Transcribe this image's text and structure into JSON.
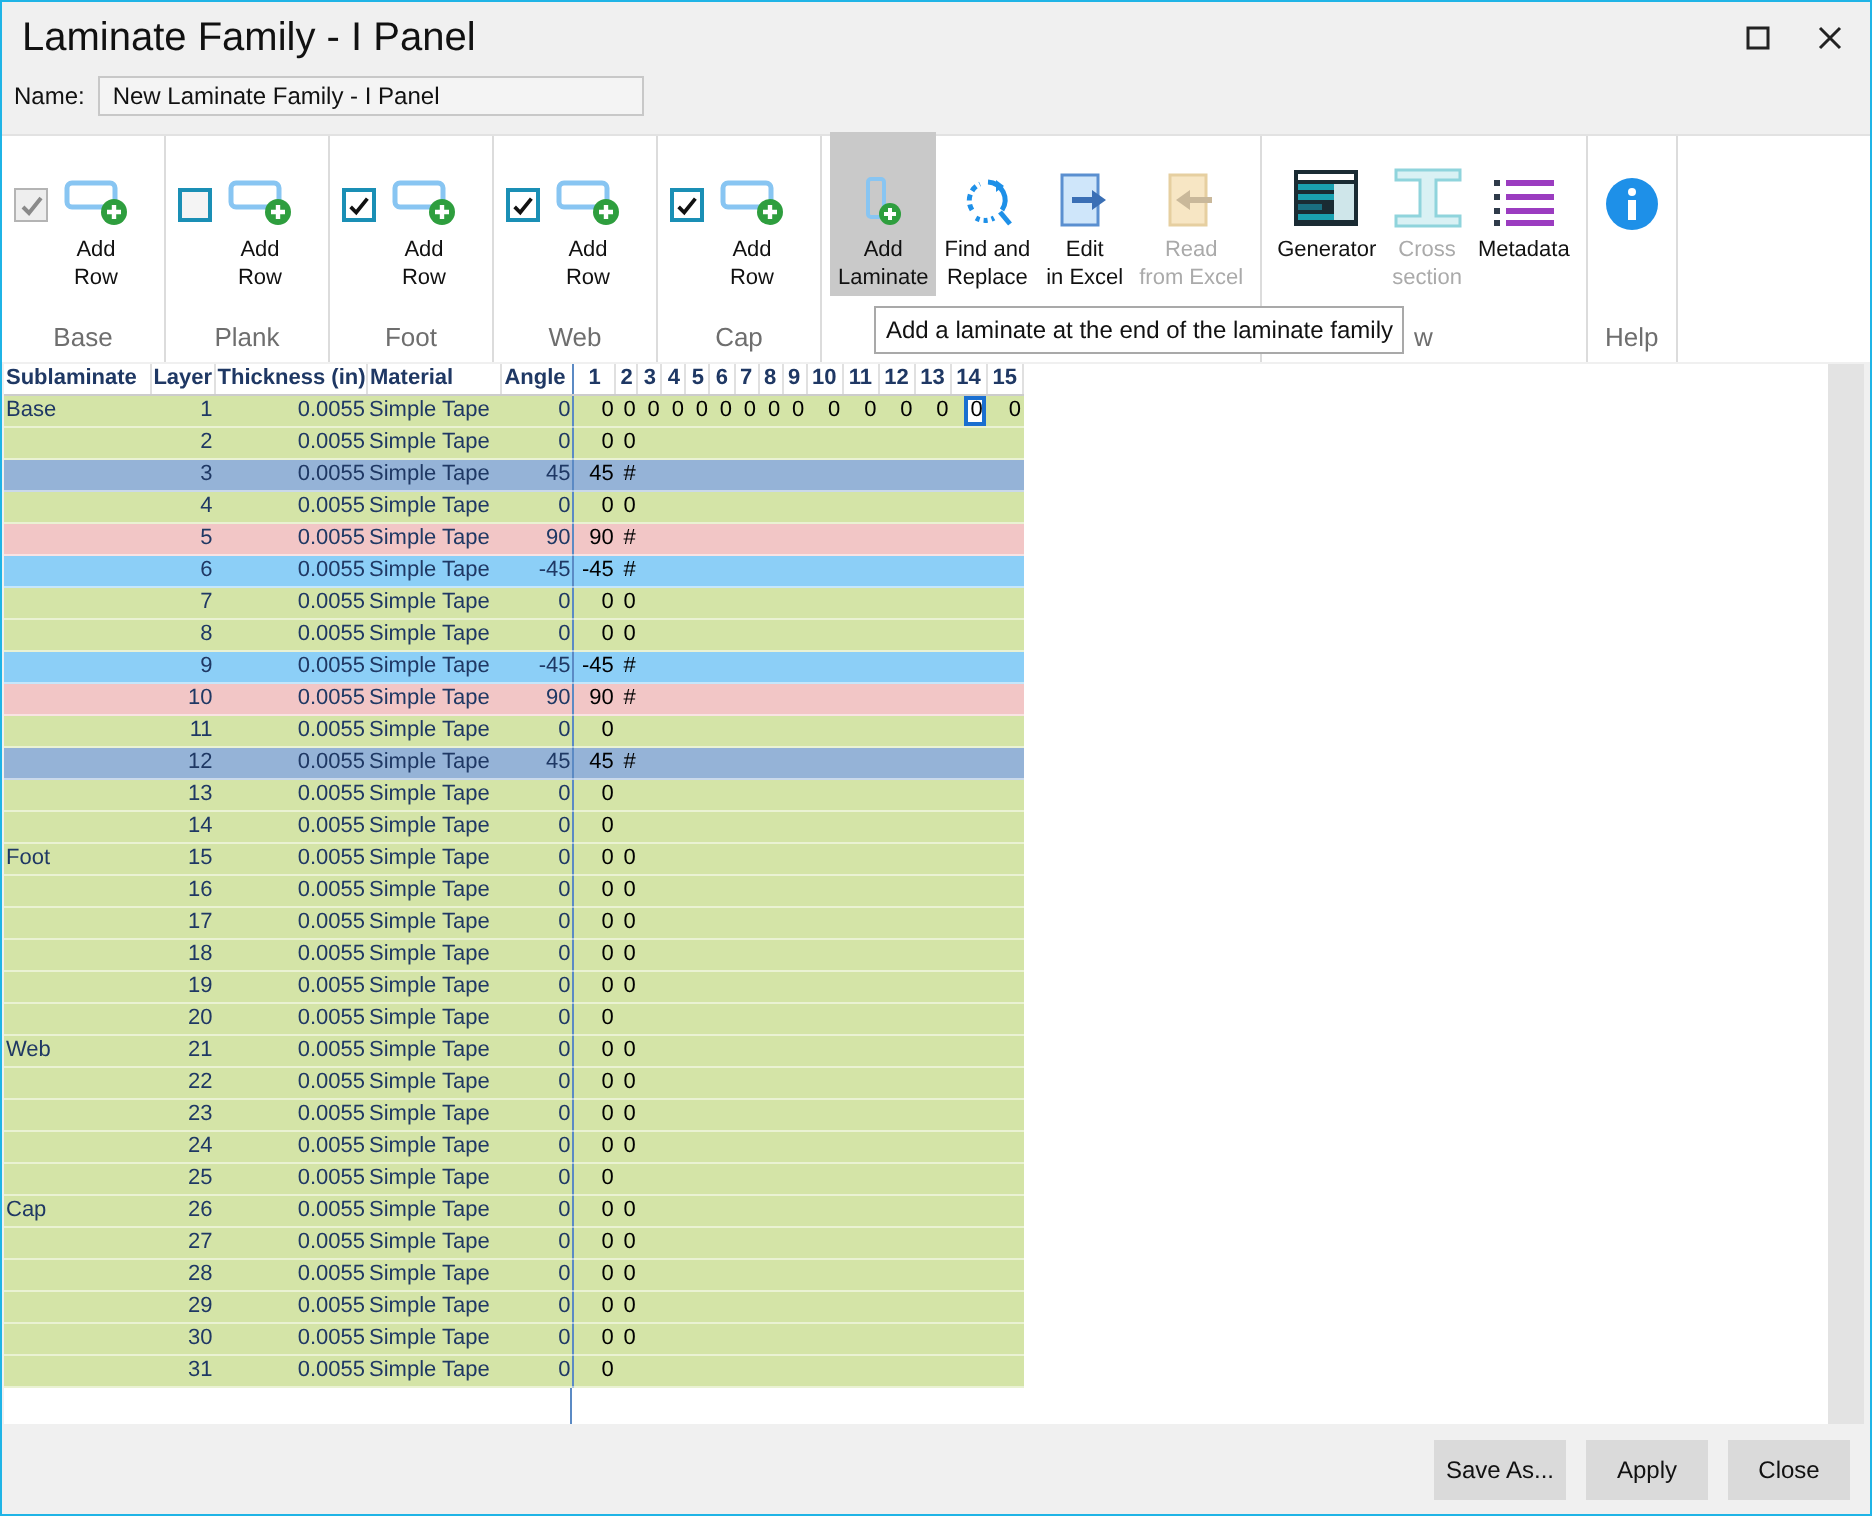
{
  "window": {
    "title": "Laminate Family - I Panel"
  },
  "name_field": {
    "label": "Name:",
    "value": "New Laminate Family - I Panel"
  },
  "ribbon": {
    "groups": [
      {
        "label": "Base",
        "checkbox": {
          "checked": true,
          "disabled": true
        },
        "buttons": [
          {
            "kind": "add_row",
            "label": "Add\nRow",
            "highlighted": false,
            "disabled": false
          }
        ]
      },
      {
        "label": "Plank",
        "checkbox": {
          "checked": false,
          "disabled": false
        },
        "buttons": [
          {
            "kind": "add_row",
            "label": "Add\nRow",
            "highlighted": false,
            "disabled": false
          }
        ]
      },
      {
        "label": "Foot",
        "checkbox": {
          "checked": true,
          "disabled": false
        },
        "buttons": [
          {
            "kind": "add_row",
            "label": "Add\nRow",
            "highlighted": false,
            "disabled": false
          }
        ]
      },
      {
        "label": "Web",
        "checkbox": {
          "checked": true,
          "disabled": false
        },
        "buttons": [
          {
            "kind": "add_row",
            "label": "Add\nRow",
            "highlighted": false,
            "disabled": false
          }
        ]
      },
      {
        "label": "Cap",
        "checkbox": {
          "checked": true,
          "disabled": false
        },
        "buttons": [
          {
            "kind": "add_row",
            "label": "Add\nRow",
            "highlighted": false,
            "disabled": false
          }
        ]
      },
      {
        "buttons": [
          {
            "kind": "add_laminate",
            "label": "Add\nLaminate",
            "highlighted": true,
            "disabled": false
          },
          {
            "kind": "find_replace",
            "label": "Find and\nReplace",
            "highlighted": false,
            "disabled": false
          },
          {
            "kind": "edit_excel",
            "label": "Edit\nin Excel",
            "highlighted": false,
            "disabled": false
          },
          {
            "kind": "read_excel",
            "label": "Read\nfrom Excel",
            "highlighted": false,
            "disabled": true
          }
        ]
      },
      {
        "label": "w",
        "buttons": [
          {
            "kind": "generator",
            "label": "Generator",
            "highlighted": false,
            "disabled": false
          },
          {
            "kind": "cross_section",
            "label": "Cross\nsection",
            "highlighted": false,
            "disabled": true
          },
          {
            "kind": "metadata",
            "label": "Metadata",
            "highlighted": false,
            "disabled": false
          }
        ]
      },
      {
        "label": "Help",
        "buttons": [
          {
            "kind": "info",
            "highlighted": false
          }
        ]
      }
    ]
  },
  "tooltip": {
    "text": "Add a laminate at the end of the laminate family"
  },
  "table": {
    "columns": [
      "Sublaminate",
      "Layer",
      "Thickness (in)",
      "Material",
      "Angle",
      "1",
      "2",
      "3",
      "4",
      "5",
      "6",
      "7",
      "8",
      "9",
      "10",
      "11",
      "12",
      "13",
      "14",
      "15"
    ],
    "rows": [
      {
        "color": "#d4e4a7",
        "cells": [
          {
            "text": "Base",
            "selected": false
          },
          {
            "text": "1",
            "selected": false
          },
          {
            "text": "0.0055",
            "selected": false
          },
          {
            "text": "Simple Tape",
            "selected": false
          },
          {
            "text": "0",
            "selected": false
          },
          {
            "text": "0",
            "selected": false
          },
          {
            "text": "0",
            "selected": false
          },
          {
            "text": "0",
            "selected": false
          },
          {
            "text": "0",
            "selected": false
          },
          {
            "text": "0",
            "selected": false
          },
          {
            "text": "0",
            "selected": false
          },
          {
            "text": "0",
            "selected": false
          },
          {
            "text": "0",
            "selected": false
          },
          {
            "text": "0",
            "selected": false
          },
          {
            "text": "0",
            "selected": false
          },
          {
            "text": "0",
            "selected": false
          },
          {
            "text": "0",
            "selected": false
          },
          {
            "text": "0",
            "selected": false
          },
          {
            "text": "0",
            "selected": true
          },
          {
            "text": "0",
            "selected": false
          }
        ]
      },
      {
        "color": "#d4e4a7",
        "cells": [
          {
            "text": "",
            "selected": false
          },
          {
            "text": "2",
            "selected": false
          },
          {
            "text": "0.0055",
            "selected": false
          },
          {
            "text": "Simple Tape",
            "selected": false
          },
          {
            "text": "0",
            "selected": false
          },
          {
            "text": "0",
            "selected": false
          },
          {
            "text": "0",
            "selected": false
          }
        ]
      },
      {
        "color": "#95b3d7",
        "cells": [
          {
            "text": "",
            "selected": false
          },
          {
            "text": "3",
            "selected": false
          },
          {
            "text": "0.0055",
            "selected": false
          },
          {
            "text": "Simple Tape",
            "selected": false
          },
          {
            "text": "45",
            "selected": false
          },
          {
            "text": "45",
            "selected": false
          },
          {
            "text": "#",
            "selected": false
          }
        ]
      },
      {
        "color": "#d4e4a7",
        "cells": [
          {
            "text": "",
            "selected": false
          },
          {
            "text": "4",
            "selected": false
          },
          {
            "text": "0.0055",
            "selected": false
          },
          {
            "text": "Simple Tape",
            "selected": false
          },
          {
            "text": "0",
            "selected": false
          },
          {
            "text": "0",
            "selected": false
          },
          {
            "text": "0",
            "selected": false
          }
        ]
      },
      {
        "color": "#f2c6c6",
        "cells": [
          {
            "text": "",
            "selected": false
          },
          {
            "text": "5",
            "selected": false
          },
          {
            "text": "0.0055",
            "selected": false
          },
          {
            "text": "Simple Tape",
            "selected": false
          },
          {
            "text": "90",
            "selected": false
          },
          {
            "text": "90",
            "selected": false
          },
          {
            "text": "#",
            "selected": false
          }
        ]
      },
      {
        "color": "#8ccff7",
        "cells": [
          {
            "text": "",
            "selected": false
          },
          {
            "text": "6",
            "selected": false
          },
          {
            "text": "0.0055",
            "selected": false
          },
          {
            "text": "Simple Tape",
            "selected": false
          },
          {
            "text": "-45",
            "selected": false
          },
          {
            "text": "-45",
            "selected": false
          },
          {
            "text": "#",
            "selected": false
          }
        ]
      },
      {
        "color": "#d4e4a7",
        "cells": [
          {
            "text": "",
            "selected": false
          },
          {
            "text": "7",
            "selected": false
          },
          {
            "text": "0.0055",
            "selected": false
          },
          {
            "text": "Simple Tape",
            "selected": false
          },
          {
            "text": "0",
            "selected": false
          },
          {
            "text": "0",
            "selected": false
          },
          {
            "text": "0",
            "selected": false
          }
        ]
      },
      {
        "color": "#d4e4a7",
        "cells": [
          {
            "text": "",
            "selected": false
          },
          {
            "text": "8",
            "selected": false
          },
          {
            "text": "0.0055",
            "selected": false
          },
          {
            "text": "Simple Tape",
            "selected": false
          },
          {
            "text": "0",
            "selected": false
          },
          {
            "text": "0",
            "selected": false
          },
          {
            "text": "0",
            "selected": false
          }
        ]
      },
      {
        "color": "#8ccff7",
        "cells": [
          {
            "text": "",
            "selected": false
          },
          {
            "text": "9",
            "selected": false
          },
          {
            "text": "0.0055",
            "selected": false
          },
          {
            "text": "Simple Tape",
            "selected": false
          },
          {
            "text": "-45",
            "selected": false
          },
          {
            "text": "-45",
            "selected": false
          },
          {
            "text": "#",
            "selected": false
          }
        ]
      },
      {
        "color": "#f2c6c6",
        "cells": [
          {
            "text": "",
            "selected": false
          },
          {
            "text": "10",
            "selected": false
          },
          {
            "text": "0.0055",
            "selected": false
          },
          {
            "text": "Simple Tape",
            "selected": false
          },
          {
            "text": "90",
            "selected": false
          },
          {
            "text": "90",
            "selected": false
          },
          {
            "text": "#",
            "selected": false
          }
        ]
      },
      {
        "color": "#d4e4a7",
        "cells": [
          {
            "text": "",
            "selected": false
          },
          {
            "text": "11",
            "selected": false
          },
          {
            "text": "0.0055",
            "selected": false
          },
          {
            "text": "Simple Tape",
            "selected": false
          },
          {
            "text": "0",
            "selected": false
          },
          {
            "text": "0",
            "selected": false
          }
        ]
      },
      {
        "color": "#95b3d7",
        "cells": [
          {
            "text": "",
            "selected": false
          },
          {
            "text": "12",
            "selected": false
          },
          {
            "text": "0.0055",
            "selected": false
          },
          {
            "text": "Simple Tape",
            "selected": false
          },
          {
            "text": "45",
            "selected": false
          },
          {
            "text": "45",
            "selected": false
          },
          {
            "text": "#",
            "selected": false
          }
        ]
      },
      {
        "color": "#d4e4a7",
        "cells": [
          {
            "text": "",
            "selected": false
          },
          {
            "text": "13",
            "selected": false
          },
          {
            "text": "0.0055",
            "selected": false
          },
          {
            "text": "Simple Tape",
            "selected": false
          },
          {
            "text": "0",
            "selected": false
          },
          {
            "text": "0",
            "selected": false
          }
        ]
      },
      {
        "color": "#d4e4a7",
        "cells": [
          {
            "text": "",
            "selected": false
          },
          {
            "text": "14",
            "selected": false
          },
          {
            "text": "0.0055",
            "selected": false
          },
          {
            "text": "Simple Tape",
            "selected": false
          },
          {
            "text": "0",
            "selected": false
          },
          {
            "text": "0",
            "selected": false
          }
        ]
      },
      {
        "color": "#d4e4a7",
        "cells": [
          {
            "text": "Foot",
            "selected": false
          },
          {
            "text": "15",
            "selected": false
          },
          {
            "text": "0.0055",
            "selected": false
          },
          {
            "text": "Simple Tape",
            "selected": false
          },
          {
            "text": "0",
            "selected": false
          },
          {
            "text": "0",
            "selected": false
          },
          {
            "text": "0",
            "selected": false
          }
        ]
      },
      {
        "color": "#d4e4a7",
        "cells": [
          {
            "text": "",
            "selected": false
          },
          {
            "text": "16",
            "selected": false
          },
          {
            "text": "0.0055",
            "selected": false
          },
          {
            "text": "Simple Tape",
            "selected": false
          },
          {
            "text": "0",
            "selected": false
          },
          {
            "text": "0",
            "selected": false
          },
          {
            "text": "0",
            "selected": false
          }
        ]
      },
      {
        "color": "#d4e4a7",
        "cells": [
          {
            "text": "",
            "selected": false
          },
          {
            "text": "17",
            "selected": false
          },
          {
            "text": "0.0055",
            "selected": false
          },
          {
            "text": "Simple Tape",
            "selected": false
          },
          {
            "text": "0",
            "selected": false
          },
          {
            "text": "0",
            "selected": false
          },
          {
            "text": "0",
            "selected": false
          }
        ]
      },
      {
        "color": "#d4e4a7",
        "cells": [
          {
            "text": "",
            "selected": false
          },
          {
            "text": "18",
            "selected": false
          },
          {
            "text": "0.0055",
            "selected": false
          },
          {
            "text": "Simple Tape",
            "selected": false
          },
          {
            "text": "0",
            "selected": false
          },
          {
            "text": "0",
            "selected": false
          },
          {
            "text": "0",
            "selected": false
          }
        ]
      },
      {
        "color": "#d4e4a7",
        "cells": [
          {
            "text": "",
            "selected": false
          },
          {
            "text": "19",
            "selected": false
          },
          {
            "text": "0.0055",
            "selected": false
          },
          {
            "text": "Simple Tape",
            "selected": false
          },
          {
            "text": "0",
            "selected": false
          },
          {
            "text": "0",
            "selected": false
          },
          {
            "text": "0",
            "selected": false
          }
        ]
      },
      {
        "color": "#d4e4a7",
        "cells": [
          {
            "text": "",
            "selected": false
          },
          {
            "text": "20",
            "selected": false
          },
          {
            "text": "0.0055",
            "selected": false
          },
          {
            "text": "Simple Tape",
            "selected": false
          },
          {
            "text": "0",
            "selected": false
          },
          {
            "text": "0",
            "selected": false
          }
        ]
      },
      {
        "color": "#d4e4a7",
        "cells": [
          {
            "text": "Web",
            "selected": false
          },
          {
            "text": "21",
            "selected": false
          },
          {
            "text": "0.0055",
            "selected": false
          },
          {
            "text": "Simple Tape",
            "selected": false
          },
          {
            "text": "0",
            "selected": false
          },
          {
            "text": "0",
            "selected": false
          },
          {
            "text": "0",
            "selected": false
          }
        ]
      },
      {
        "color": "#d4e4a7",
        "cells": [
          {
            "text": "",
            "selected": false
          },
          {
            "text": "22",
            "selected": false
          },
          {
            "text": "0.0055",
            "selected": false
          },
          {
            "text": "Simple Tape",
            "selected": false
          },
          {
            "text": "0",
            "selected": false
          },
          {
            "text": "0",
            "selected": false
          },
          {
            "text": "0",
            "selected": false
          }
        ]
      },
      {
        "color": "#d4e4a7",
        "cells": [
          {
            "text": "",
            "selected": false
          },
          {
            "text": "23",
            "selected": false
          },
          {
            "text": "0.0055",
            "selected": false
          },
          {
            "text": "Simple Tape",
            "selected": false
          },
          {
            "text": "0",
            "selected": false
          },
          {
            "text": "0",
            "selected": false
          },
          {
            "text": "0",
            "selected": false
          }
        ]
      },
      {
        "color": "#d4e4a7",
        "cells": [
          {
            "text": "",
            "selected": false
          },
          {
            "text": "24",
            "selected": false
          },
          {
            "text": "0.0055",
            "selected": false
          },
          {
            "text": "Simple Tape",
            "selected": false
          },
          {
            "text": "0",
            "selected": false
          },
          {
            "text": "0",
            "selected": false
          },
          {
            "text": "0",
            "selected": false
          }
        ]
      },
      {
        "color": "#d4e4a7",
        "cells": [
          {
            "text": "",
            "selected": false
          },
          {
            "text": "25",
            "selected": false
          },
          {
            "text": "0.0055",
            "selected": false
          },
          {
            "text": "Simple Tape",
            "selected": false
          },
          {
            "text": "0",
            "selected": false
          },
          {
            "text": "0",
            "selected": false
          }
        ]
      },
      {
        "color": "#d4e4a7",
        "cells": [
          {
            "text": "Cap",
            "selected": false
          },
          {
            "text": "26",
            "selected": false
          },
          {
            "text": "0.0055",
            "selected": false
          },
          {
            "text": "Simple Tape",
            "selected": false
          },
          {
            "text": "0",
            "selected": false
          },
          {
            "text": "0",
            "selected": false
          },
          {
            "text": "0",
            "selected": false
          }
        ]
      },
      {
        "color": "#d4e4a7",
        "cells": [
          {
            "text": "",
            "selected": false
          },
          {
            "text": "27",
            "selected": false
          },
          {
            "text": "0.0055",
            "selected": false
          },
          {
            "text": "Simple Tape",
            "selected": false
          },
          {
            "text": "0",
            "selected": false
          },
          {
            "text": "0",
            "selected": false
          },
          {
            "text": "0",
            "selected": false
          }
        ]
      },
      {
        "color": "#d4e4a7",
        "cells": [
          {
            "text": "",
            "selected": false
          },
          {
            "text": "28",
            "selected": false
          },
          {
            "text": "0.0055",
            "selected": false
          },
          {
            "text": "Simple Tape",
            "selected": false
          },
          {
            "text": "0",
            "selected": false
          },
          {
            "text": "0",
            "selected": false
          },
          {
            "text": "0",
            "selected": false
          }
        ]
      },
      {
        "color": "#d4e4a7",
        "cells": [
          {
            "text": "",
            "selected": false
          },
          {
            "text": "29",
            "selected": false
          },
          {
            "text": "0.0055",
            "selected": false
          },
          {
            "text": "Simple Tape",
            "selected": false
          },
          {
            "text": "0",
            "selected": false
          },
          {
            "text": "0",
            "selected": false
          },
          {
            "text": "0",
            "selected": false
          }
        ]
      },
      {
        "color": "#d4e4a7",
        "cells": [
          {
            "text": "",
            "selected": false
          },
          {
            "text": "30",
            "selected": false
          },
          {
            "text": "0.0055",
            "selected": false
          },
          {
            "text": "Simple Tape",
            "selected": false
          },
          {
            "text": "0",
            "selected": false
          },
          {
            "text": "0",
            "selected": false
          },
          {
            "text": "0",
            "selected": false
          }
        ]
      },
      {
        "color": "#d4e4a7",
        "cells": [
          {
            "text": "",
            "selected": false
          },
          {
            "text": "31",
            "selected": false
          },
          {
            "text": "0.0055",
            "selected": false
          },
          {
            "text": "Simple Tape",
            "selected": false
          },
          {
            "text": "0",
            "selected": false
          },
          {
            "text": "0",
            "selected": false
          }
        ]
      }
    ]
  },
  "buttons": [
    "Save As...",
    "Apply",
    "Close"
  ]
}
